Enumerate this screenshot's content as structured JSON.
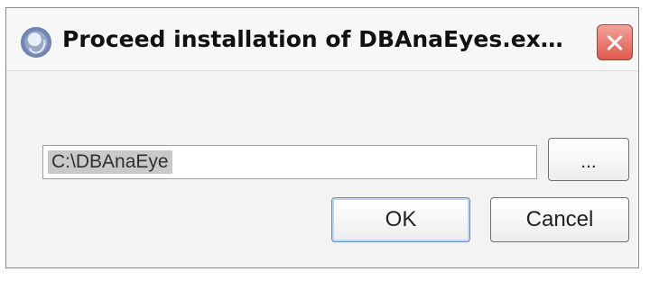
{
  "window": {
    "title": "Proceed installation of DBAnaEyes.ex…",
    "icon": "app-icon",
    "close_icon": "close-icon"
  },
  "content": {
    "path_value": "C:\\DBAnaEye",
    "browse_label": "...",
    "ok_label": "OK",
    "cancel_label": "Cancel"
  },
  "colors": {
    "close_button": "#e0584d",
    "selection": "#c9c9c9",
    "default_button_focus": "#bcd6ef"
  }
}
